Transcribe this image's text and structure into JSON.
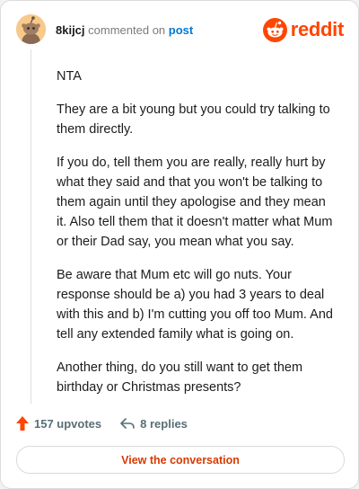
{
  "header": {
    "username": "8kijcj",
    "commented_on": "commented on",
    "post_link": "post",
    "brand": "reddit"
  },
  "comment": {
    "paragraphs": [
      "NTA",
      "They are a bit young but you could try talking to them directly.",
      "If you do, tell them you are really, really hurt by what they said and that you won't be talking to them again until they apologise and they mean it. Also tell them that it doesn't matter what Mum or their Dad say, you mean what you say.",
      "Be aware that Mum etc will go nuts. Your response should be a) you had 3 years to deal with this and b) I'm cutting you off too Mum. And tell any extended family what is going on.",
      "Another thing, do you still want to get them birthday or Christmas presents?"
    ]
  },
  "actions": {
    "upvotes": "157 upvotes",
    "replies": "8 replies"
  },
  "cta": {
    "label": "View the conversation"
  },
  "colors": {
    "brand": "#ff4500",
    "link": "#0079d3",
    "cta_text": "#d93a00",
    "muted": "#576f76"
  },
  "icons": [
    "snoo-avatar-icon",
    "reddit-logo-icon",
    "upvote-arrow-icon",
    "reply-arrow-icon"
  ]
}
